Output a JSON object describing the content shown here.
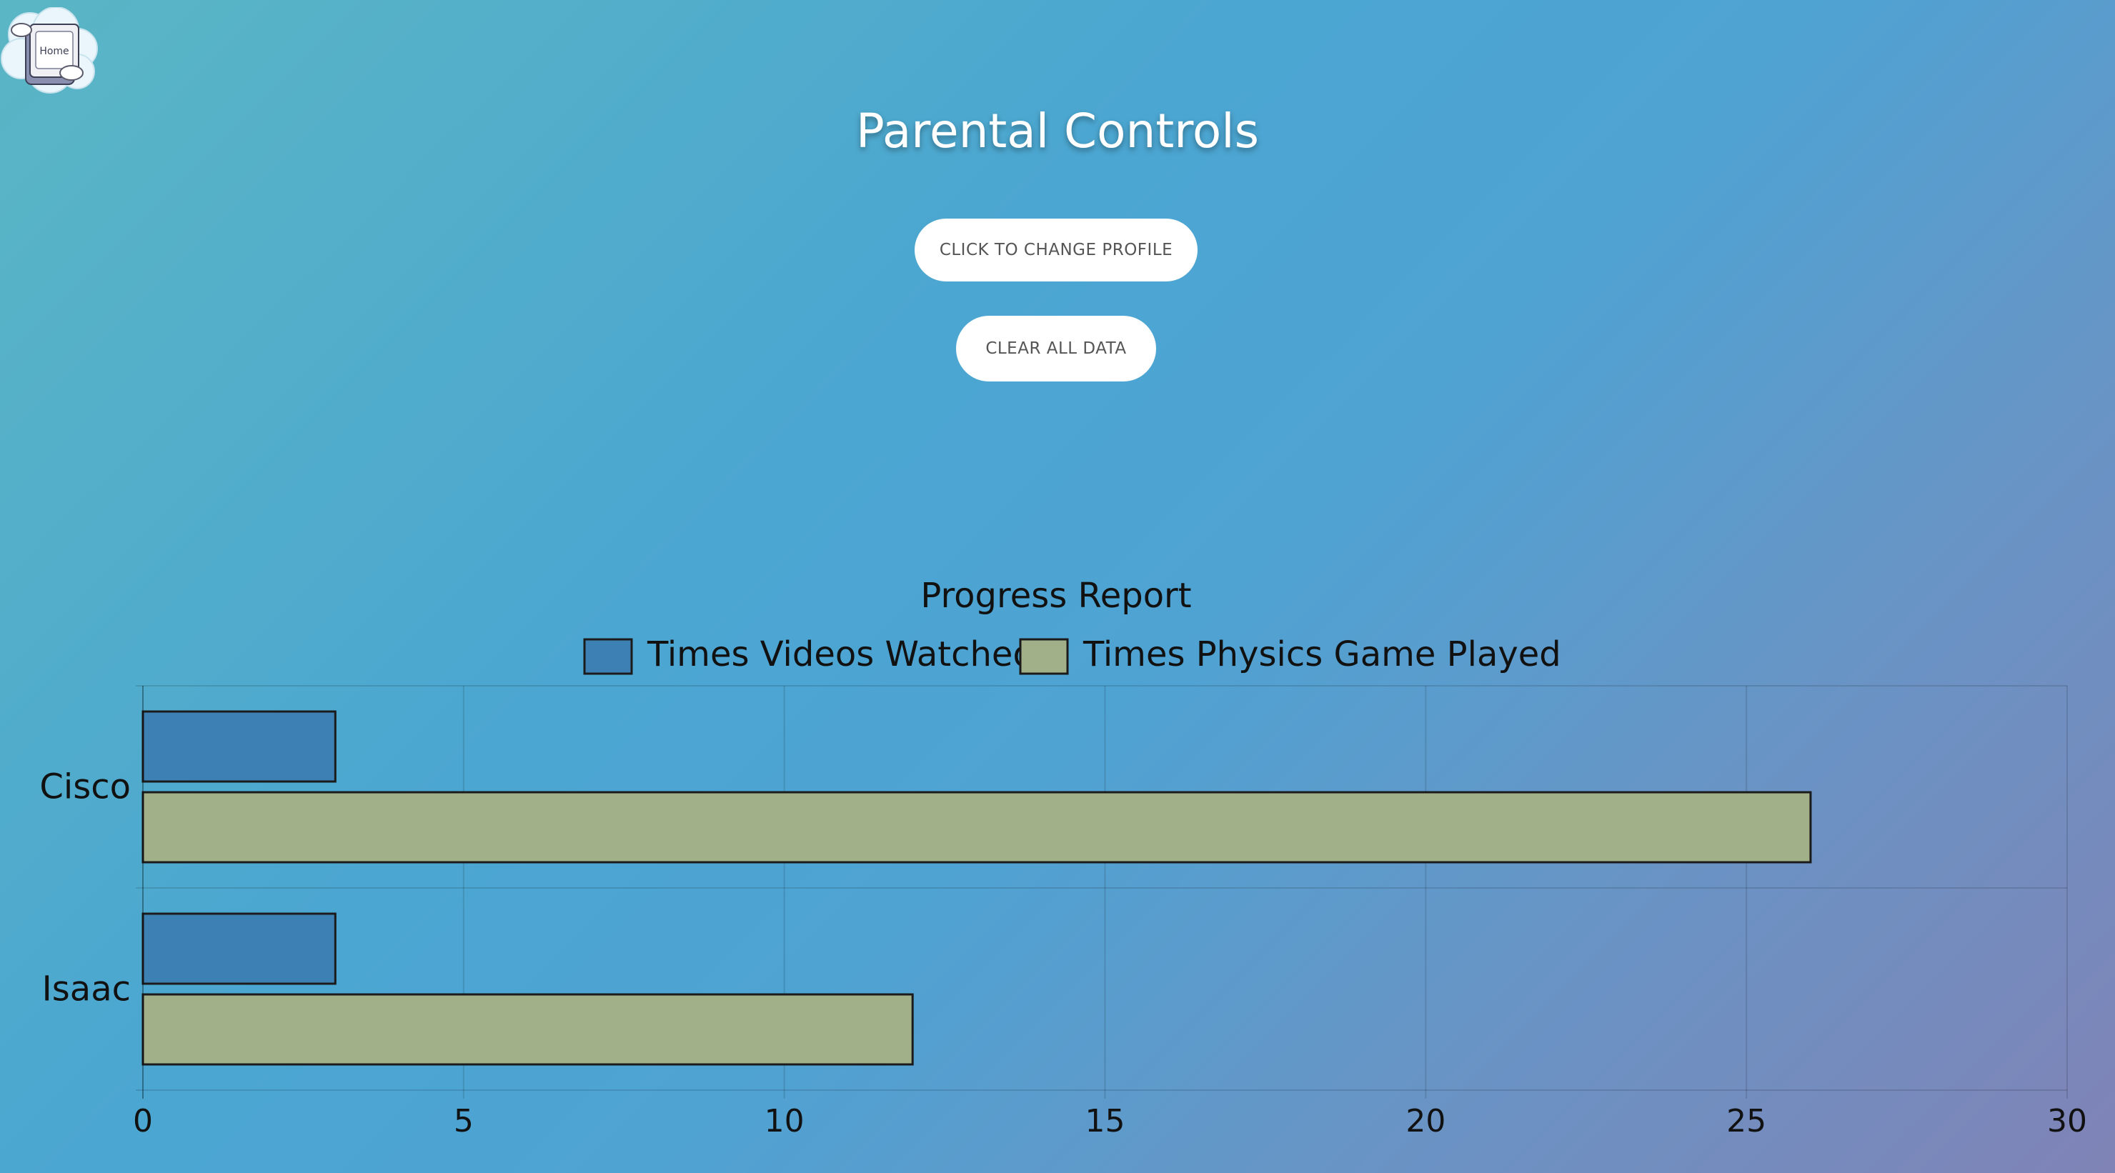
{
  "home": {
    "label": "Home"
  },
  "page": {
    "title": "Parental Controls"
  },
  "buttons": {
    "change_profile": "CLICK TO CHANGE PROFILE",
    "clear_data": "CLEAR ALL DATA"
  },
  "colors": {
    "videos_series": "#3d80b4",
    "game_series": "#a2b08a",
    "button_bg": "#ffffff",
    "title_text": "#ffffff"
  },
  "chart_data": {
    "type": "bar",
    "orientation": "horizontal",
    "title": "Progress Report",
    "categories": [
      "Cisco",
      "Isaac"
    ],
    "series": [
      {
        "name": "Times Videos Watched",
        "values": [
          3,
          3
        ]
      },
      {
        "name": "Times Physics Game Played",
        "values": [
          26,
          12
        ]
      }
    ],
    "xlim": [
      0,
      30
    ],
    "xticks": [
      0,
      5,
      10,
      15,
      20,
      25,
      30
    ],
    "grid": true,
    "legend": "top"
  }
}
